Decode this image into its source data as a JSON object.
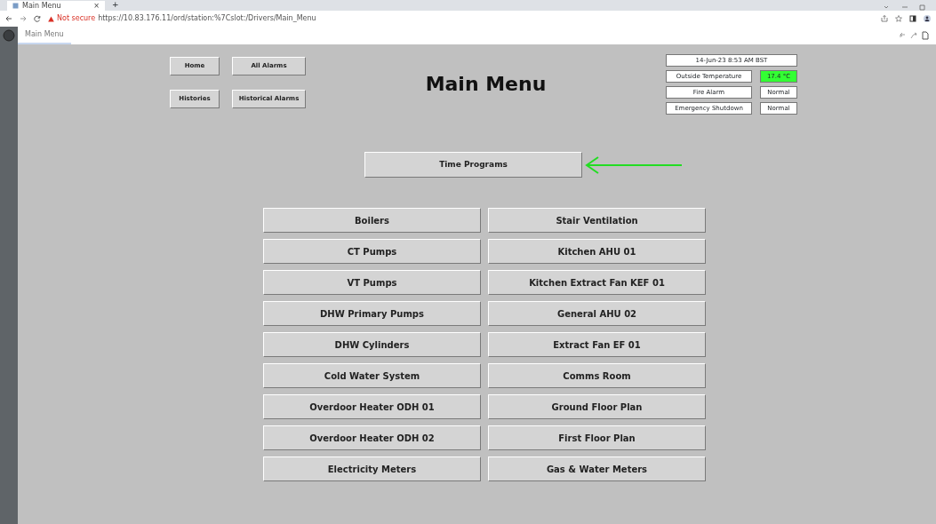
{
  "browser": {
    "tab_title": "Main Menu",
    "close": "×",
    "new_tab": "+",
    "security": "Not secure",
    "url": "https://10.83.176.11/ord/station:%7Cslot:/Drivers/Main_Menu"
  },
  "viewer_tab": {
    "label": "Main Menu",
    "selected": true
  },
  "nav_buttons": [
    {
      "label": "Home"
    },
    {
      "label": "All Alarms"
    },
    {
      "label": "Histories"
    },
    {
      "label": "Historical Alarms"
    }
  ],
  "title": "Main Menu",
  "status": {
    "datetime": "14-Jun-23 8:53 AM BST",
    "rows": [
      {
        "label": "Outside Temperature",
        "value": "17.4 °C",
        "color": "#33ff33"
      },
      {
        "label": "Fire Alarm",
        "value": "Normal",
        "color": "#ffffff"
      },
      {
        "label": "Emergency Shutdown",
        "value": "Normal",
        "color": "#ffffff"
      }
    ]
  },
  "featured_button": {
    "label": "Time Programs",
    "arrow": true
  },
  "menu_left": [
    "Boilers",
    "CT Pumps",
    "VT Pumps",
    "DHW Primary Pumps",
    "DHW Cylinders",
    "Cold Water System",
    "Overdoor Heater ODH 01",
    "Overdoor Heater ODH 02",
    "Electricity Meters"
  ],
  "menu_right": [
    "Stair Ventilation",
    "Kitchen AHU 01",
    "Kitchen Extract Fan KEF 01",
    "General AHU 02",
    "Extract Fan EF 01",
    "Comms Room",
    "Ground Floor Plan",
    "First Floor Plan",
    "Gas & Water Meters"
  ]
}
